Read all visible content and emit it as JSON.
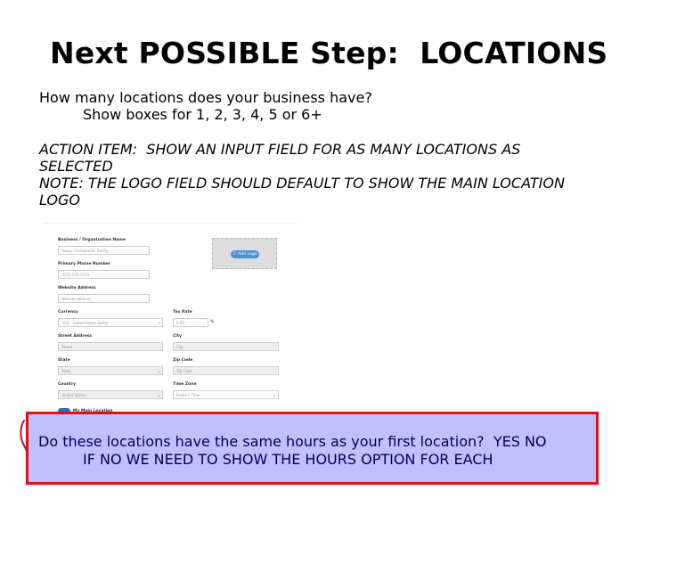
{
  "heading": "Next POSSIBLE Step:  LOCATIONS",
  "question": "How many locations does your business have?",
  "show_boxes": "Show boxes for 1, 2, 3, 4, 5 or 6+",
  "action_item_line1": "ACTION ITEM:  SHOW AN INPUT FIELD FOR AS MANY LOCATIONS AS",
  "action_item_line2": "SELECTED",
  "note_line1": "NOTE: THE LOGO FIELD SHOULD DEFAULT TO SHOW THE MAIN LOCATION",
  "note_line2": "LOGO",
  "form": {
    "business_name_label": "Business / Organization Name",
    "business_name_value": "Happy Chiropractic Family",
    "add_logo_label": "1. Add Logo",
    "phone_label": "Primary Phone Number",
    "phone_value": "(555) 555-5555",
    "website_label": "Website Address",
    "website_value": "Website Address",
    "currency_label": "Currency",
    "currency_value": "USD - United States Dollar",
    "tax_rate_label": "Tax Rate",
    "tax_rate_value": "0.00",
    "tax_rate_unit": "%",
    "street_label": "Street Address",
    "street_value": "Street",
    "city_label": "City",
    "city_value": "City",
    "state_label": "State",
    "state_value": "State",
    "zip_label": "Zip Code",
    "zip_value": "Zip Code",
    "country_label": "Country",
    "country_value": "United States",
    "timezone_label": "Time Zone",
    "timezone_value": "Eastern Time",
    "toggle_label": "My Main Location"
  },
  "hours_question": "Do these locations have the same hours as your first location?  YES NO",
  "hours_followup": "IF NO WE NEED TO SHOW THE HOURS OPTION FOR EACH",
  "colors": {
    "highlight_bg": "#c0c0ff",
    "highlight_border": "#e0101a",
    "highlight_text": "#000055"
  }
}
